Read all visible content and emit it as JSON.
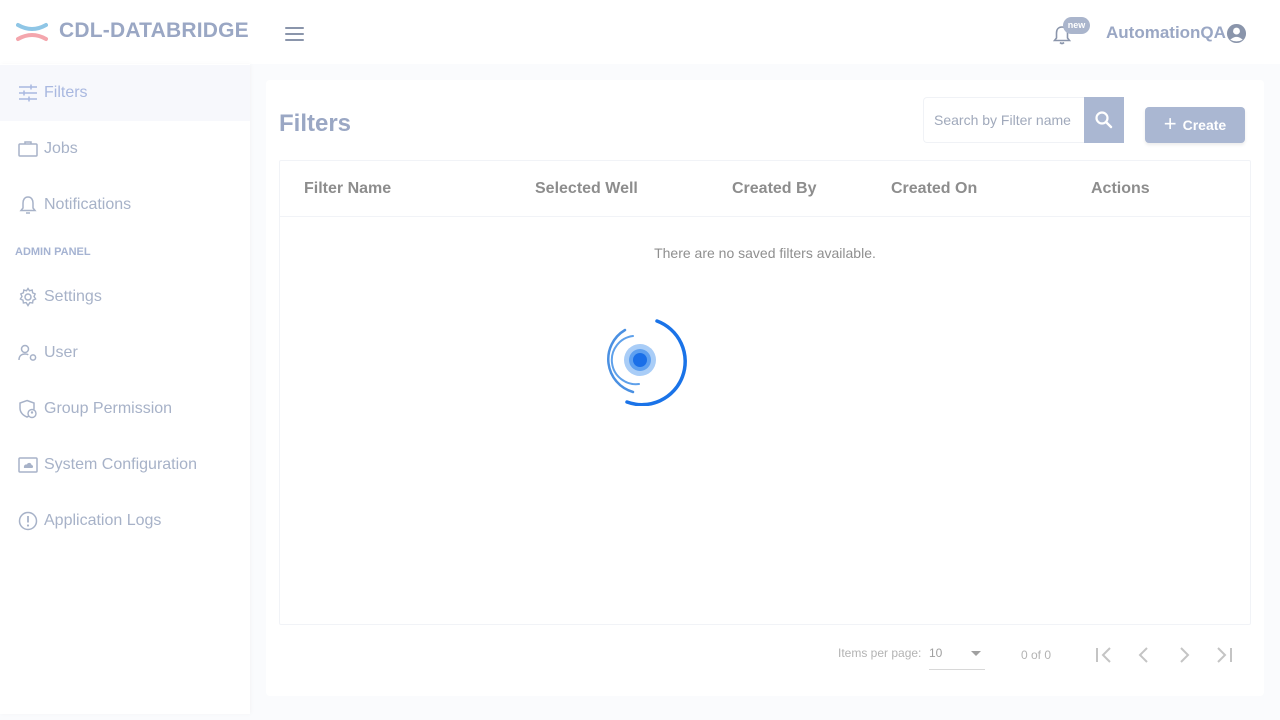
{
  "header": {
    "brand": "CDL-DATABRIDGE",
    "notification_badge": "new",
    "username": "AutomationQA"
  },
  "sidebar": {
    "items": [
      {
        "label": "Filters",
        "icon": "sliders-icon",
        "active": true
      },
      {
        "label": "Jobs",
        "icon": "briefcase-icon"
      },
      {
        "label": "Notifications",
        "icon": "bell-icon"
      }
    ],
    "admin_section": "ADMIN PANEL",
    "admin_items": [
      {
        "label": "Settings",
        "icon": "gear-icon"
      },
      {
        "label": "User",
        "icon": "user-gear-icon"
      },
      {
        "label": "Group Permission",
        "icon": "shield-user-icon"
      },
      {
        "label": "System Configuration",
        "icon": "cloud-monitor-icon"
      },
      {
        "label": "Application Logs",
        "icon": "alert-circle-icon"
      }
    ]
  },
  "main": {
    "title": "Filters",
    "search_placeholder": "Search by Filter name",
    "create_label": "Create",
    "columns": [
      "Filter Name",
      "Selected Well",
      "Created By",
      "Created On",
      "Actions"
    ],
    "empty_message": "There are no saved filters available."
  },
  "paginator": {
    "items_per_page_label": "Items per page:",
    "page_size": "10",
    "range_label": "0 of 0"
  },
  "colors": {
    "accent": "#aab7d2",
    "spinner": "#1a73e8"
  }
}
